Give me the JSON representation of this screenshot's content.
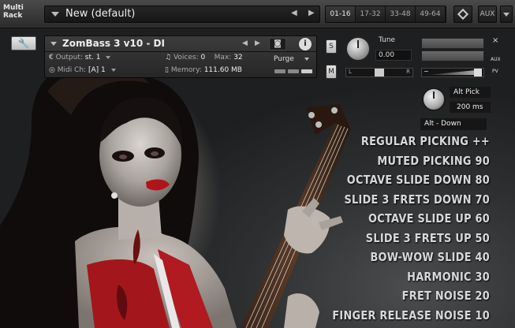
{
  "multirack": {
    "label": "Multi Rack",
    "rack_name": "New (default)",
    "prev": "◀",
    "next": "▶",
    "range_tabs": [
      "01-16",
      "17-32",
      "33-48",
      "49-64"
    ],
    "active_tab": "01-16",
    "aux_label": "AUX"
  },
  "instrument": {
    "name": "ZomBass 3 v10 - DI",
    "prev": "◀",
    "next": "▶",
    "camera_icon": "camera-icon",
    "info_label": "i",
    "output_label": "Output:",
    "output_value": "st. 1",
    "midi_label": "Midi Ch:",
    "midi_value": "[A]  1",
    "voices_label": "Voices:",
    "voices_value": "0",
    "max_label": "Max:",
    "max_value": "32",
    "memory_label": "Memory:",
    "memory_value": "111.60 MB",
    "purge_label": "Purge",
    "solo_label": "S",
    "mute_label": "M",
    "tune_label": "Tune",
    "tune_value": "0.00",
    "pan_left": "L",
    "pan_right": "R",
    "close_label": "×",
    "aux_small": "AUX",
    "pv_small": "PV",
    "vol_minus": "−"
  },
  "alt_pick": {
    "label": "Alt Pick",
    "value": "200  ms",
    "mode": "Alt - Down"
  },
  "articulations": [
    "REGULAR PICKING ++",
    "MUTED PICKING 90",
    "OCTAVE SLIDE DOWN 80",
    "SLIDE 3 FRETS DOWN 70",
    "OCTAVE SLIDE UP 60",
    "SLIDE 3 FRETS UP 50",
    "BOW-WOW SLIDE 40",
    "HARMONIC 30",
    "FRET NOISE 20",
    "FINGER RELEASE NOISE 10"
  ],
  "colors": {
    "panel_dark": "#1b1b1b",
    "text_light": "#d8d8d8",
    "lips_red": "#b0141a"
  }
}
